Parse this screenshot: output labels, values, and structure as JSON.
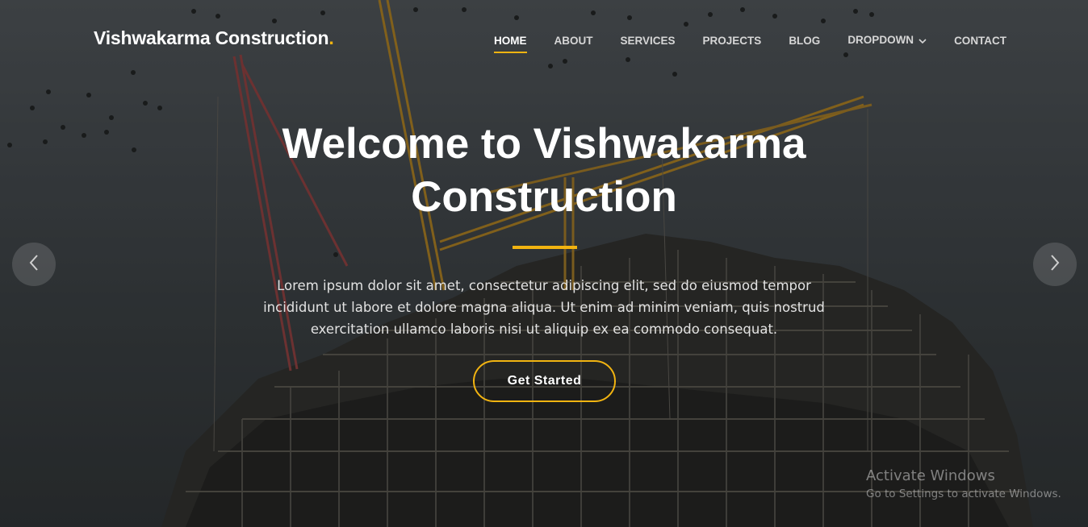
{
  "header": {
    "logo_text": "Vishwakarma Construction",
    "logo_dot": ".",
    "nav": [
      {
        "label": "HOME",
        "active": true
      },
      {
        "label": "ABOUT",
        "active": false
      },
      {
        "label": "SERVICES",
        "active": false
      },
      {
        "label": "PROJECTS",
        "active": false
      },
      {
        "label": "BLOG",
        "active": false
      },
      {
        "label": "DROPDOWN",
        "active": false,
        "icon": "chevron-down-icon"
      },
      {
        "label": "CONTACT",
        "active": false
      }
    ]
  },
  "hero": {
    "title": "Welcome to Vishwakarma Construction",
    "description": "Lorem ipsum dolor sit amet, consectetur adipiscing elit, sed do eiusmod tempor incididunt ut labore et dolore magna aliqua. Ut enim ad minim veniam, quis nostrud exercitation ullamco laboris nisi ut aliquip ex ea commodo consequat.",
    "cta_label": "Get Started",
    "prev_icon": "chevron-left-icon",
    "next_icon": "chevron-right-icon"
  },
  "watermark": {
    "title": "Activate Windows",
    "subtitle": "Go to Settings to activate Windows."
  },
  "colors": {
    "accent": "#f2b411",
    "text": "#ffffff",
    "nav_text": "#d6d6d6"
  }
}
